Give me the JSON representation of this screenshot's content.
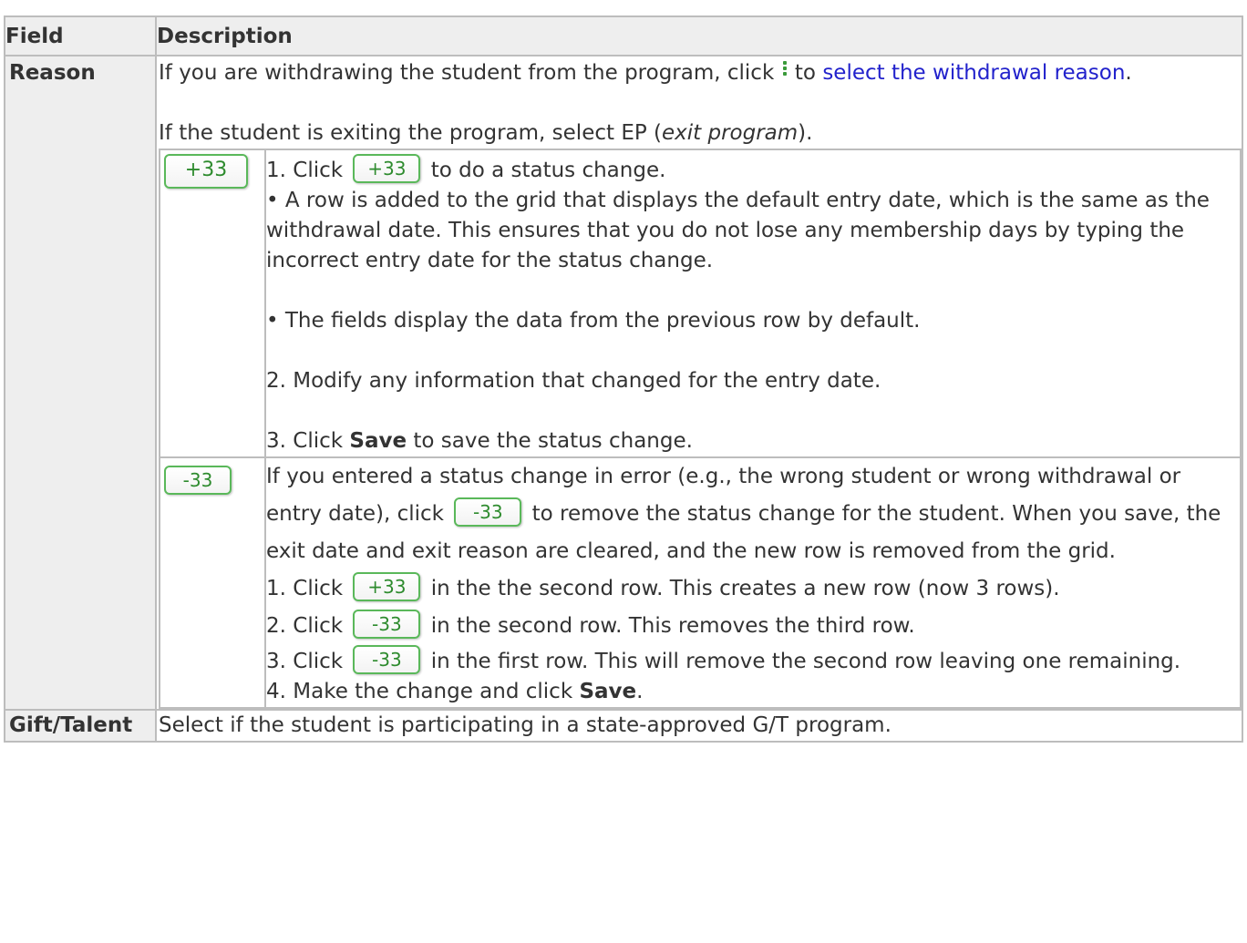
{
  "headers": {
    "field": "Field",
    "description": "Description"
  },
  "reason": {
    "field": "Reason",
    "intro_before": "If you are withdrawing the student from the program, click",
    "intro_mid": "to",
    "intro_link": "select the withdrawal reason",
    "intro_after": ".",
    "exit_before": "If the student is exiting the program, select EP (",
    "exit_italic": "exit program",
    "exit_after": ").",
    "add": {
      "button_label": "+33",
      "step1_before": "1. Click",
      "step1_after": "to do a status change.",
      "bullet1": "• A row is added to the grid that displays the default entry date, which is the same as the withdrawal date. This ensures that you do not lose any membership days by typing the incorrect entry date for the status change.",
      "bullet2": "• The fields display the data from the previous row by default.",
      "step2": "2. Modify any information that changed for the entry date.",
      "step3_before": "3. Click",
      "step3_bold": "Save",
      "step3_after": "to save the status change."
    },
    "remove": {
      "button_label": "-33",
      "para_before": "If you entered a status change in error (e.g., the wrong student or wrong withdrawal or entry date), click",
      "para_after": "to remove the status change for the student. When you save, the exit date and exit reason are cleared, and the new row is removed from the grid.",
      "s1_before": "1. Click",
      "s1_btn": "+33",
      "s1_after": "in the the second row. This creates a new row (now 3 rows).",
      "s2_before": "2. Click",
      "s2_btn": "-33",
      "s2_after": "in the second row. This removes the third row.",
      "s3_before": "3. Click",
      "s3_btn": "-33",
      "s3_after": "in the first row. This will remove the second row leaving one remaining.",
      "s4_before": "4. Make the change and click",
      "s4_bold": "Save",
      "s4_after": "."
    }
  },
  "gift": {
    "field": "Gift/Talent",
    "description": "Select if the student is participating in a state-approved G/T program."
  },
  "colors": {
    "button_green": "#5ab85a",
    "link": "#2222cc",
    "header_bg": "#eeeeee"
  }
}
